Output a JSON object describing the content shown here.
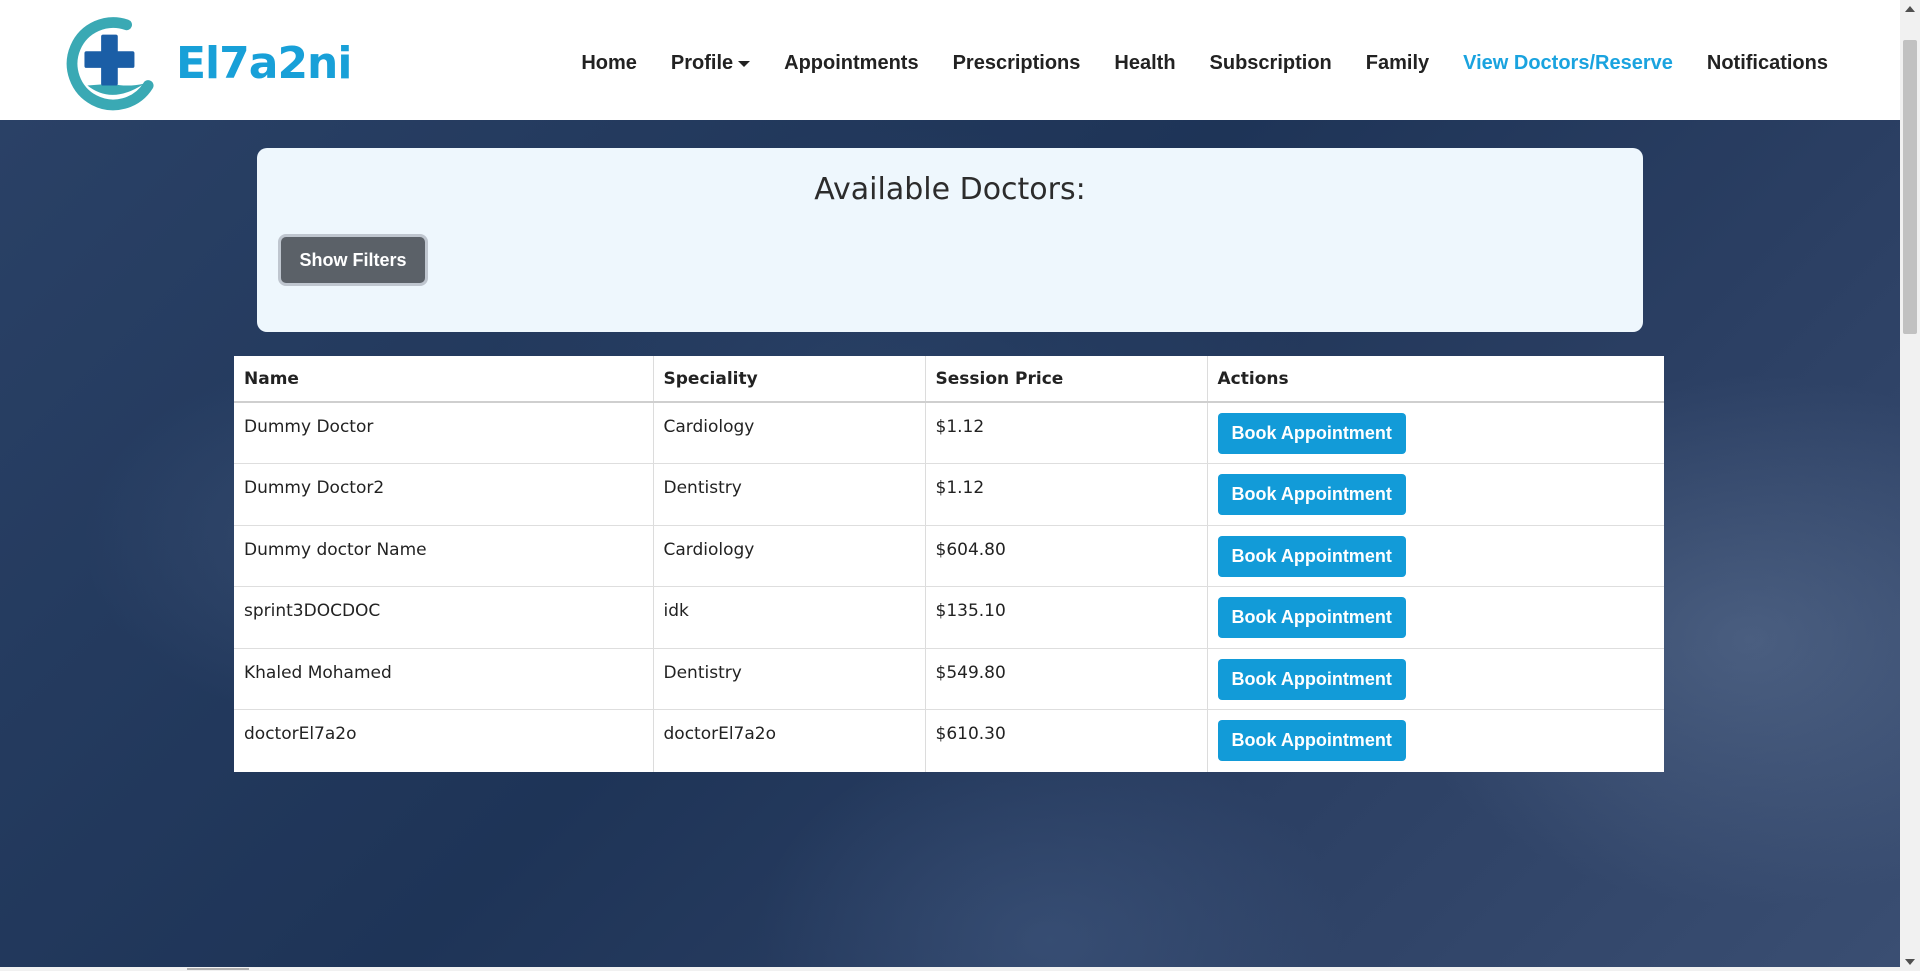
{
  "brand": {
    "name": "El7a2ni",
    "logo_icon": "medical-cross-hand-icon",
    "accent_color": "#18a0d8"
  },
  "nav": {
    "items": [
      {
        "label": "Home",
        "active": false
      },
      {
        "label": "Profile",
        "active": false,
        "dropdown": true
      },
      {
        "label": "Appointments",
        "active": false
      },
      {
        "label": "Prescriptions",
        "active": false
      },
      {
        "label": "Health",
        "active": false
      },
      {
        "label": "Subscription",
        "active": false
      },
      {
        "label": "Family",
        "active": false
      },
      {
        "label": "View Doctors/Reserve",
        "active": true
      },
      {
        "label": "Notifications",
        "active": false
      }
    ]
  },
  "panel": {
    "title": "Available Doctors:",
    "filters_button": "Show Filters"
  },
  "table": {
    "headers": [
      "Name",
      "Speciality",
      "Session Price",
      "Actions"
    ],
    "action_label": "Book Appointment",
    "rows": [
      {
        "name": "Dummy Doctor",
        "speciality": "Cardiology",
        "price": "$1.12"
      },
      {
        "name": "Dummy Doctor2",
        "speciality": "Dentistry",
        "price": "$1.12"
      },
      {
        "name": "Dummy doctor Name",
        "speciality": "Cardiology",
        "price": "$604.80"
      },
      {
        "name": "sprint3DOCDOC",
        "speciality": "idk",
        "price": "$135.10"
      },
      {
        "name": "Khaled Mohamed",
        "speciality": "Dentistry",
        "price": "$549.80"
      },
      {
        "name": "doctorEl7a2o",
        "speciality": "doctorEl7a2o",
        "price": "$610.30"
      }
    ]
  }
}
